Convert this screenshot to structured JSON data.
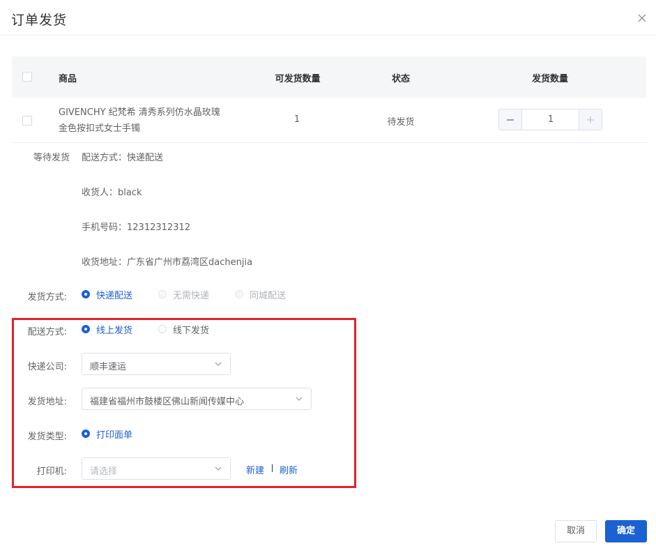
{
  "dialog": {
    "title": "订单发货"
  },
  "table": {
    "headers": {
      "product": "商品",
      "available_qty": "可发货数量",
      "status": "状态",
      "ship_qty": "发货数量"
    },
    "rows": [
      {
        "product_line1": "GIVENCHY 纪梵希 清秀系列仿水晶玫瑰",
        "product_line2": "金色按扣式女士手镯",
        "available_qty": "1",
        "status": "待发货",
        "ship_qty": "1"
      }
    ]
  },
  "order_info": {
    "waiting_label": "等待发货",
    "delivery_method": "配送方式：快递配送",
    "receiver": "收货人：black",
    "phone": "手机号码：12312312312",
    "address": "收货地址：广东省广州市荔湾区dachenjia"
  },
  "form": {
    "ship_method": {
      "label": "发货方式:",
      "options": [
        {
          "label": "快递配送",
          "state": "checked"
        },
        {
          "label": "无需快递",
          "state": "disabled"
        },
        {
          "label": "同城配送",
          "state": "disabled"
        }
      ]
    },
    "dispatch_method": {
      "label": "配送方式:",
      "options": [
        {
          "label": "线上发货",
          "state": "checked"
        },
        {
          "label": "线下发货",
          "state": "normal"
        }
      ]
    },
    "courier": {
      "label": "快递公司:",
      "value": "顺丰速运"
    },
    "ship_address": {
      "label": "发货地址:",
      "value": "福建省福州市鼓楼区佛山新闻传媒中心"
    },
    "ship_type": {
      "label": "发货类型:",
      "options": [
        {
          "label": "打印面单",
          "state": "checked"
        }
      ]
    },
    "printer": {
      "label": "打印机:",
      "placeholder": "请选择",
      "new_link": "新建",
      "refresh_link": "刷新"
    }
  },
  "footer": {
    "cancel_label": "取消",
    "confirm_label": "确定"
  },
  "colors": {
    "primary": "#1a61d2",
    "highlight_border": "#e3212a",
    "header_bg": "#f5f6f7"
  }
}
